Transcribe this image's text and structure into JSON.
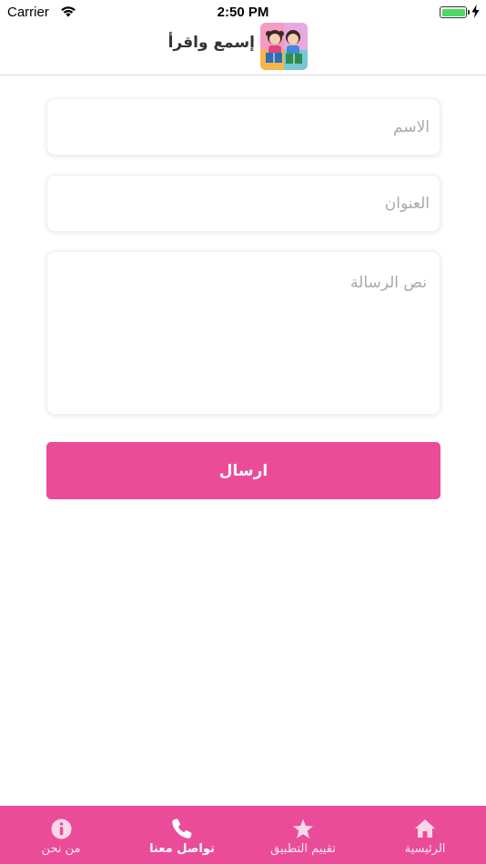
{
  "status_bar": {
    "carrier": "Carrier",
    "time": "2:50 PM"
  },
  "header": {
    "title": "إسمع واقرأ",
    "logo_icon": "kids-reading-logo"
  },
  "form": {
    "name_placeholder": "الاسم",
    "subject_placeholder": "العنوان",
    "message_placeholder": "نص الرسالة",
    "send_label": "ارسال"
  },
  "tab_bar": {
    "tabs": [
      {
        "label": "الرئيسية",
        "icon": "home-icon",
        "active": false
      },
      {
        "label": "تقييم التطبيق",
        "icon": "star-icon",
        "active": false
      },
      {
        "label": "تواصل معنا",
        "icon": "phone-icon",
        "active": true
      },
      {
        "label": "من نحن",
        "icon": "info-icon",
        "active": false
      }
    ]
  },
  "colors": {
    "accent": "#ea4c9a",
    "battery": "#4cd964",
    "placeholder": "#a9a9ae"
  }
}
